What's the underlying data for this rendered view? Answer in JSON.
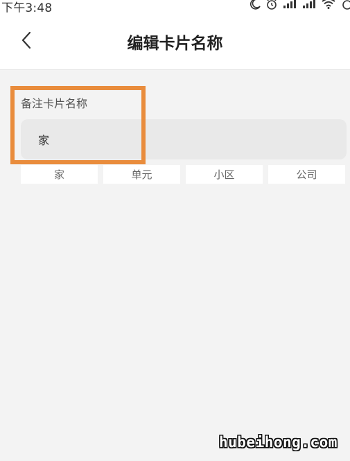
{
  "status_bar": {
    "time": "下午3:48",
    "icons": [
      "moon-icon",
      "alarm-icon",
      "signal-icon",
      "signal-icon",
      "wifi-icon",
      "battery-icon"
    ]
  },
  "header": {
    "back_icon": "chevron-left-icon",
    "title": "编辑卡片名称"
  },
  "form": {
    "label": "备注卡片名称",
    "input_value": "家"
  },
  "options": [
    "家",
    "单元",
    "小区",
    "公司"
  ],
  "highlight_color": "#e98c3c",
  "watermark": "hubeihong.com"
}
